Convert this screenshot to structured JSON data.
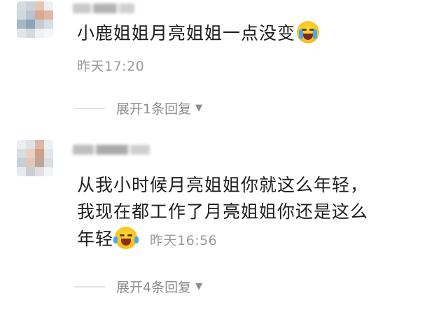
{
  "comments": [
    {
      "text_line1": "小鹿姐姐月亮姐姐一点没变",
      "emoji": "crying-face-icon",
      "time": "昨天17:20",
      "replies_label": "展开1条回复",
      "avatar_colors": [
        "#c9d2dc",
        "#e7c3b4",
        "#d9a894",
        "#b9c4cf",
        "#cfd9e3",
        "#e0b6a4",
        "#a8b7c6",
        "#d6dde4",
        "#eef1f4",
        "#c7ccd2",
        "#e2e6ea",
        "#d3d9df"
      ]
    },
    {
      "text_line1": "从我小时候月亮姐姐你就这么年轻，",
      "text_line2": "我现在都工作了月亮姐姐你还是这么",
      "text_line3": "年轻",
      "emoji": "tears-of-joy-icon",
      "time": "昨天16:56",
      "replies_label": "展开4条回复",
      "avatar_colors": [
        "#dfe3e7",
        "#d8b9a8",
        "#e9d2c4",
        "#c5cfd8",
        "#e7c7b6",
        "#cf9f88",
        "#d7dde3",
        "#e4e7ea",
        "#b9a79c",
        "#eceff1",
        "#d9dee2",
        "#c8ced4"
      ]
    }
  ],
  "colors": {
    "text": "#1d1d1d",
    "meta": "#9a9a9a",
    "divider": "#e4e4e4"
  }
}
